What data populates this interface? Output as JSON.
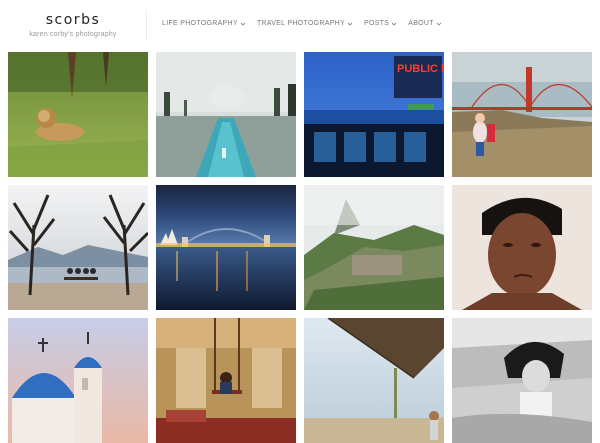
{
  "site": {
    "title": "scorbs",
    "tagline": "karen corby's photography"
  },
  "nav": [
    {
      "label": "LIFE PHOTOGRAPHY",
      "icon": "chevron-down-icon"
    },
    {
      "label": "TRAVEL PHOTOGRAPHY",
      "icon": "chevron-down-icon"
    },
    {
      "label": "POSTS",
      "icon": "chevron-down-icon"
    },
    {
      "label": "ABOUT",
      "icon": "chevron-down-icon"
    }
  ],
  "photos": [
    {
      "subject": "lion-in-grass"
    },
    {
      "subject": "taj-mahal-reflecting-pool"
    },
    {
      "subject": "public-market-sign"
    },
    {
      "subject": "golden-gate-bridge-child"
    },
    {
      "subject": "bench-between-trees"
    },
    {
      "subject": "sydney-harbour-bridge-night"
    },
    {
      "subject": "machu-picchu"
    },
    {
      "subject": "man-portrait"
    },
    {
      "subject": "santorini-blue-dome"
    },
    {
      "subject": "swing-in-ornate-room"
    },
    {
      "subject": "thatched-umbrella-beach"
    },
    {
      "subject": "girl-on-beach"
    }
  ],
  "signage": {
    "market_sign": "PUBLIC MARKET"
  }
}
